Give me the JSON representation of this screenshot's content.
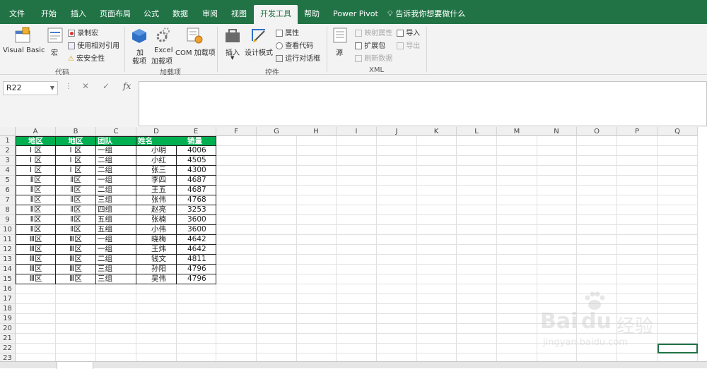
{
  "menu": {
    "tabs": [
      "文件",
      "开始",
      "插入",
      "页面布局",
      "公式",
      "数据",
      "审阅",
      "视图",
      "开发工具",
      "帮助",
      "Power Pivot"
    ],
    "active": "开发工具",
    "tellme": "告诉我你想要做什么"
  },
  "ribbon": {
    "code": {
      "visual_basic": "Visual Basic",
      "macros": "宏",
      "record_macro": "录制宏",
      "relative_ref": "使用相对引用",
      "macro_security": "宏安全性",
      "label": "代码"
    },
    "addins": {
      "addins_1": "加",
      "addins_2": "载项",
      "excel_addins_1": "Excel",
      "excel_addins_2": "加载项",
      "com_addins": "COM 加载项",
      "label": "加载项"
    },
    "controls": {
      "insert": "插入",
      "design_mode": "设计模式",
      "properties": "属性",
      "view_code": "查看代码",
      "run_dialog": "运行对话框",
      "label": "控件"
    },
    "xml": {
      "source": "源",
      "map_properties": "映射属性",
      "expansion_packs": "扩展包",
      "refresh_data": "刷新数据",
      "import": "导入",
      "export": "导出",
      "label": "XML"
    }
  },
  "formula_bar": {
    "name_box": "R22",
    "fx": "fx",
    "formula": ""
  },
  "sheet": {
    "columns": [
      "A",
      "B",
      "C",
      "D",
      "E",
      "F",
      "G",
      "H",
      "I",
      "J",
      "K",
      "L",
      "M",
      "N",
      "O",
      "P",
      "Q"
    ],
    "rows": [
      "1",
      "2",
      "3",
      "4",
      "5",
      "6",
      "7",
      "8",
      "9",
      "10",
      "11",
      "12",
      "13",
      "14",
      "15",
      "16",
      "17",
      "18",
      "19",
      "20",
      "21",
      "22",
      "23"
    ],
    "header": [
      "地区",
      "地区",
      "团队",
      "姓名",
      "销量"
    ],
    "data": [
      [
        "Ⅰ 区",
        "Ⅰ 区",
        "一组",
        "小明",
        "4006"
      ],
      [
        "Ⅰ 区",
        "Ⅰ 区",
        "二组",
        "小红",
        "4505"
      ],
      [
        "Ⅰ 区",
        "Ⅰ 区",
        "二组",
        "张三",
        "4300"
      ],
      [
        "Ⅱ区",
        "Ⅱ区",
        "一组",
        "李四",
        "4687"
      ],
      [
        "Ⅱ区",
        "Ⅱ区",
        "二组",
        "王五",
        "4687"
      ],
      [
        "Ⅱ区",
        "Ⅱ区",
        "三组",
        "张伟",
        "4768"
      ],
      [
        "Ⅱ区",
        "Ⅱ区",
        "四组",
        "赵亮",
        "3253"
      ],
      [
        "Ⅱ区",
        "Ⅱ区",
        "五组",
        "张楠",
        "3600"
      ],
      [
        "Ⅱ区",
        "Ⅱ区",
        "五组",
        "小伟",
        "3600"
      ],
      [
        "Ⅲ区",
        "Ⅲ区",
        "一组",
        "晓梅",
        "4642"
      ],
      [
        "Ⅲ区",
        "Ⅲ区",
        "一组",
        "王炜",
        "4642"
      ],
      [
        "Ⅲ区",
        "Ⅲ区",
        "二组",
        "钱文",
        "4811"
      ],
      [
        "Ⅲ区",
        "Ⅲ区",
        "三组",
        "孙阳",
        "4796"
      ],
      [
        "Ⅲ区",
        "Ⅲ区",
        "三组",
        "吴伟",
        "4796"
      ]
    ]
  },
  "watermark": {
    "brand": "Bai",
    "brand_cn": "经验",
    "url": "jingyan.baidu.com"
  },
  "colors": {
    "ribbon_green": "#217346",
    "header_fill": "#00b050"
  }
}
